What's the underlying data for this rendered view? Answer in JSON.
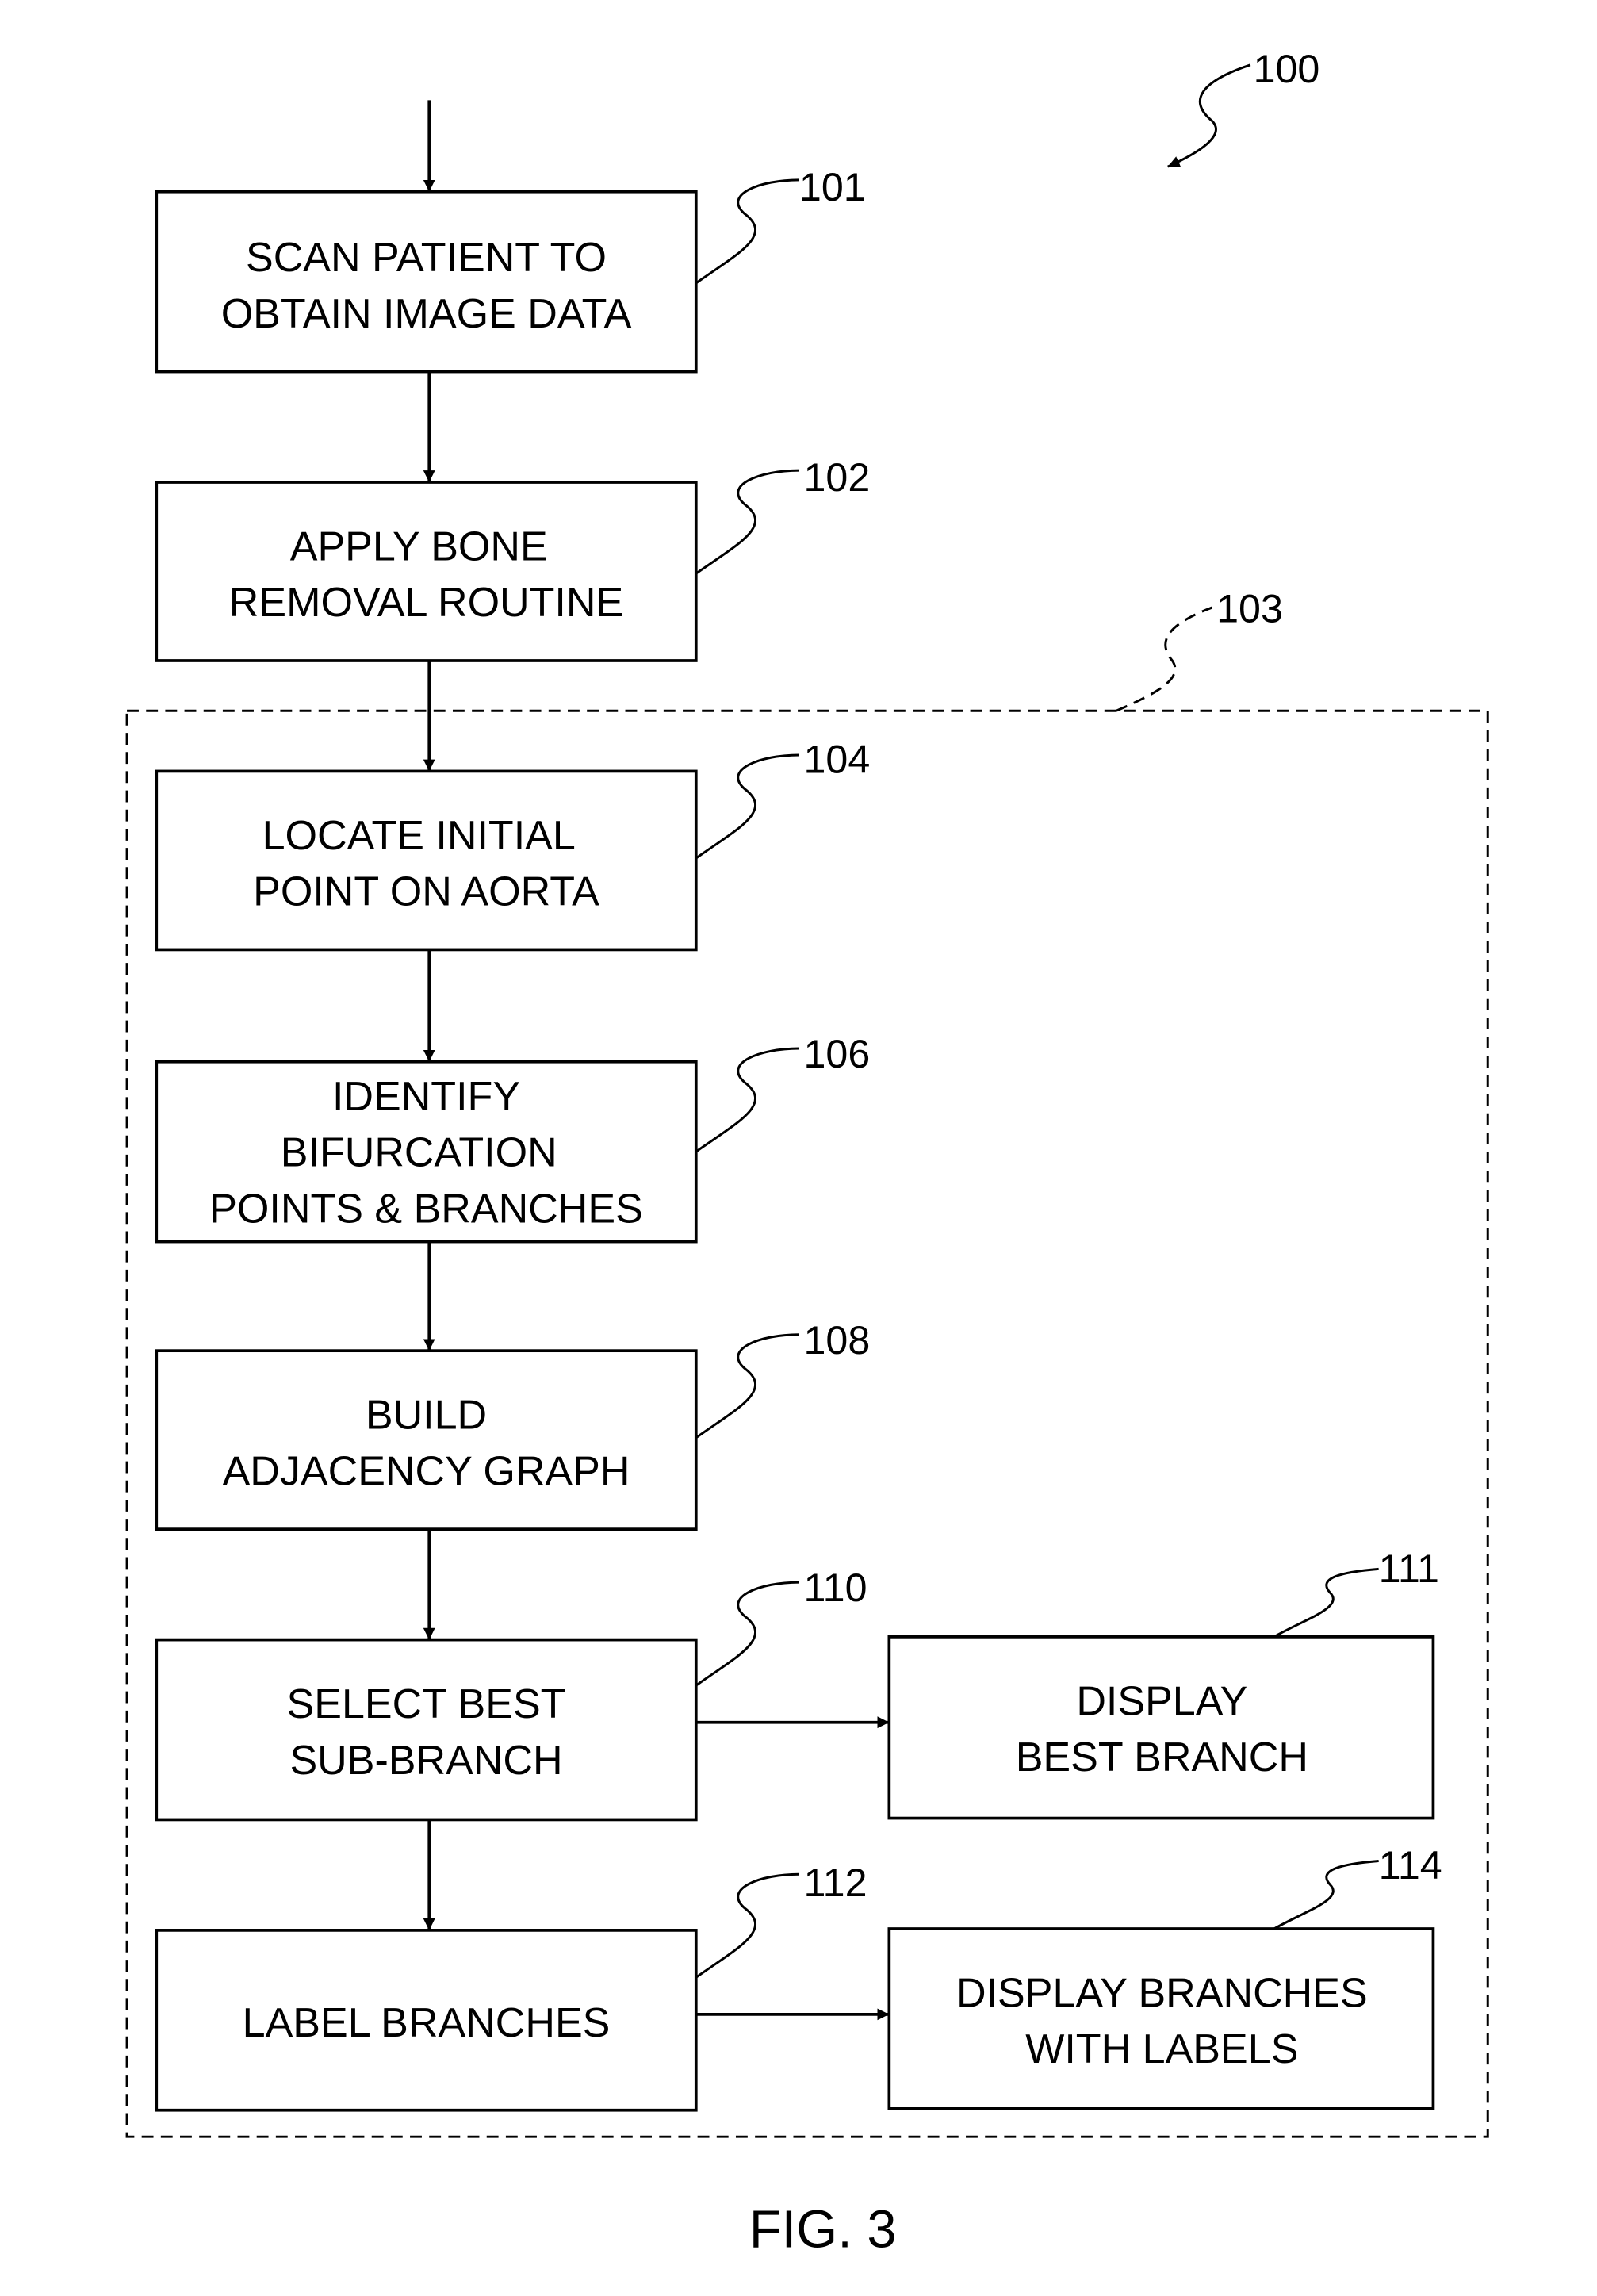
{
  "figure": {
    "caption": "FIG. 3",
    "overall_ref": "100",
    "group": {
      "ref": "103",
      "style": "dashed"
    }
  },
  "steps": [
    {
      "ref": "101",
      "lines": [
        "SCAN PATIENT TO",
        "OBTAIN IMAGE DATA"
      ]
    },
    {
      "ref": "102",
      "lines": [
        "APPLY BONE",
        "REMOVAL ROUTINE"
      ]
    },
    {
      "ref": "104",
      "lines": [
        "LOCATE INITIAL",
        "POINT ON AORTA"
      ]
    },
    {
      "ref": "106",
      "lines": [
        "IDENTIFY",
        "BIFURCATION",
        "POINTS & BRANCHES"
      ]
    },
    {
      "ref": "108",
      "lines": [
        "BUILD",
        "ADJACENCY GRAPH"
      ]
    },
    {
      "ref": "110",
      "lines": [
        "SELECT BEST",
        "SUB-BRANCH"
      ]
    },
    {
      "ref": "111",
      "lines": [
        "DISPLAY",
        "BEST BRANCH"
      ]
    },
    {
      "ref": "112",
      "lines": [
        "LABEL BRANCHES"
      ]
    },
    {
      "ref": "114",
      "lines": [
        "DISPLAY BRANCHES",
        "WITH LABELS"
      ]
    }
  ],
  "flow": [
    [
      "start",
      "101"
    ],
    [
      "101",
      "102"
    ],
    [
      "102",
      "104"
    ],
    [
      "104",
      "106"
    ],
    [
      "106",
      "108"
    ],
    [
      "108",
      "110"
    ],
    [
      "110",
      "111"
    ],
    [
      "110",
      "112"
    ],
    [
      "112",
      "114"
    ]
  ]
}
